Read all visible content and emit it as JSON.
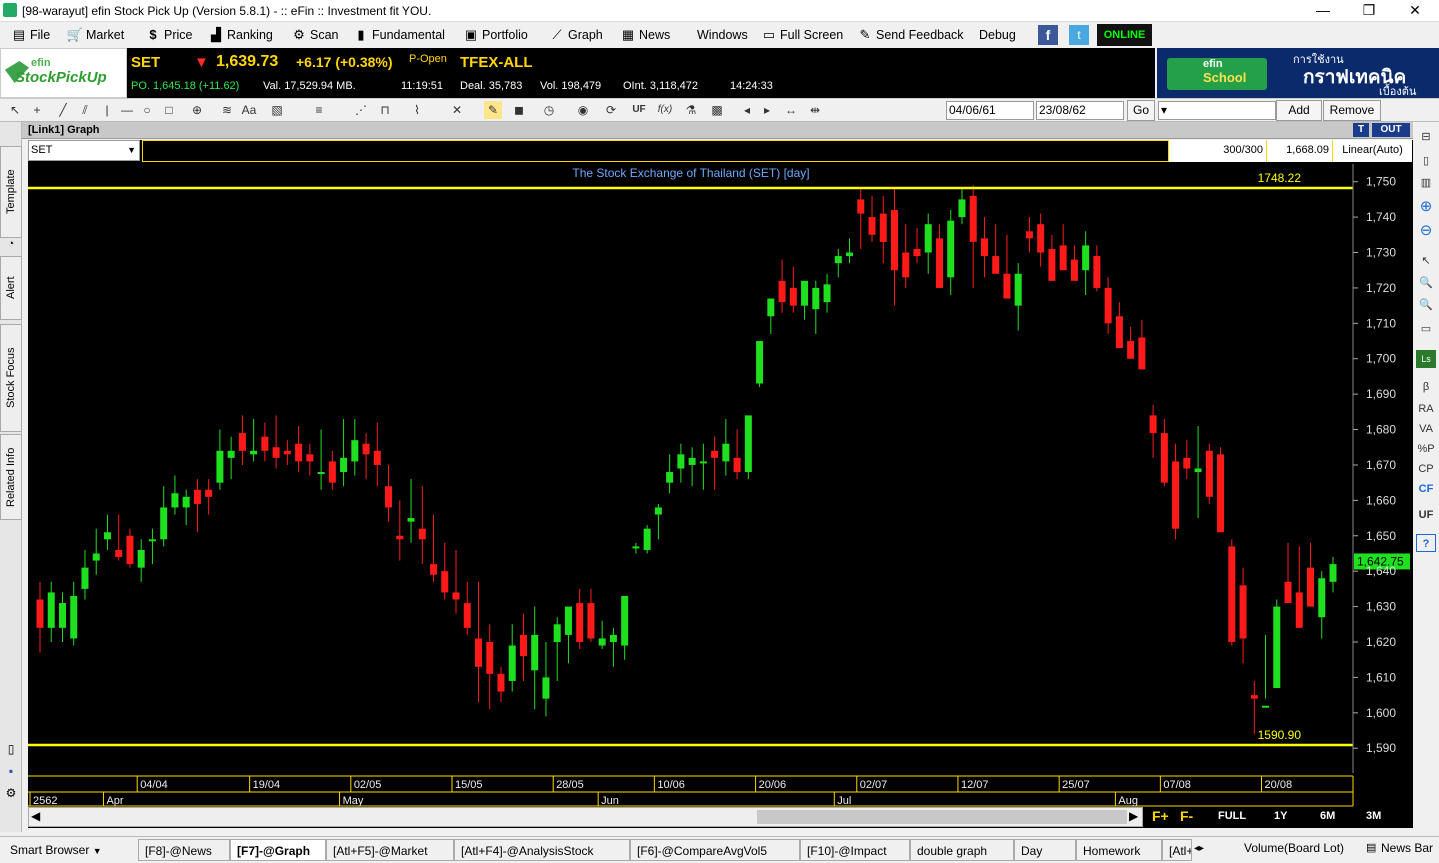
{
  "window": {
    "title": "[98-warayut] efin Stock Pick Up (Version 5.8.1) - :: eFin :: Investment fit YOU.",
    "min": "—",
    "max": "❐",
    "close": "✕"
  },
  "menu": [
    {
      "label": "File",
      "icon": "▤"
    },
    {
      "label": "Market",
      "icon": "🛒"
    },
    {
      "label": "Price",
      "icon": "$"
    },
    {
      "label": "Ranking",
      "icon": "▟"
    },
    {
      "label": "Scan",
      "icon": "⚙"
    },
    {
      "label": "Fundamental",
      "icon": "▮"
    },
    {
      "label": "Portfolio",
      "icon": "▣"
    },
    {
      "label": "Graph",
      "icon": "⟋"
    },
    {
      "label": "News",
      "icon": "▦"
    },
    {
      "label": "Windows",
      "icon": ""
    },
    {
      "label": "Full Screen",
      "icon": "▭"
    },
    {
      "label": "Send Feedback",
      "icon": "✎"
    },
    {
      "label": "Debug",
      "icon": ""
    }
  ],
  "online": "ONLINE",
  "logo": {
    "line1": "efin",
    "line2": "StockPickUp"
  },
  "quote": {
    "symbol": "SET",
    "arrow": "▼",
    "price": "1,639.73",
    "change": "+6.17 (+0.38%)",
    "status": "P-Open",
    "po": "PO. 1,645.18 (+11.62)",
    "val": "Val. 17,529.94 MB.",
    "time1": "11:19:51",
    "tfex": "TFEX-ALL",
    "deal": "Deal. 35,783",
    "vol": "Vol. 198,479",
    "oint": "OInt. 3,118,472",
    "time2": "14:24:33"
  },
  "banner": {
    "brand1": "efin",
    "brand2": "School",
    "th1": "การใช้งาน",
    "th2": "กราฟเทคนิค",
    "th3": "เบื้องต้น"
  },
  "toolbar": {
    "date_from": "04/06/61",
    "date_to": "23/08/62",
    "go": "Go",
    "add": "Add",
    "remove": "Remove"
  },
  "left_tabs": [
    "Template",
    "Alert",
    "Stock Focus",
    "Related Info"
  ],
  "right_icons": [
    "β",
    "RA",
    "VA",
    "%P",
    "CP",
    "CF",
    "UF",
    "?"
  ],
  "panel": {
    "title": "[Link1] Graph",
    "t": "T",
    "out": "OUT",
    "symbol": "SET",
    "count": "300/300",
    "last": "1,668.09",
    "scale": "Linear(Auto)"
  },
  "chart_data": {
    "type": "candlestick",
    "title": "The Stock Exchange of Thailand (SET) [day]",
    "ylim": [
      1583,
      1755
    ],
    "yticks": [
      1590,
      1600,
      1610,
      1620,
      1630,
      1640,
      1650,
      1660,
      1670,
      1680,
      1690,
      1700,
      1710,
      1720,
      1730,
      1740,
      1750
    ],
    "hlines": [
      {
        "value": 1748.22,
        "label": "1748.22"
      },
      {
        "value": 1590.9,
        "label": "1590.90"
      }
    ],
    "last_price": "1,642.75",
    "last_value": 1642.75,
    "date_ticks": [
      {
        "i": 9,
        "label": "04/04"
      },
      {
        "i": 19,
        "label": "19/04"
      },
      {
        "i": 28,
        "label": "02/05"
      },
      {
        "i": 37,
        "label": "15/05"
      },
      {
        "i": 46,
        "label": "28/05"
      },
      {
        "i": 55,
        "label": "10/06"
      },
      {
        "i": 64,
        "label": "20/06"
      },
      {
        "i": 73,
        "label": "02/07"
      },
      {
        "i": 82,
        "label": "12/07"
      },
      {
        "i": 91,
        "label": "25/07"
      },
      {
        "i": 100,
        "label": "07/08"
      },
      {
        "i": 109,
        "label": "20/08"
      }
    ],
    "month_ticks": [
      {
        "i": 0,
        "label": "2562"
      },
      {
        "i": 6,
        "label": "Apr"
      },
      {
        "i": 27,
        "label": "May"
      },
      {
        "i": 50,
        "label": "Jun"
      },
      {
        "i": 71,
        "label": "Jul"
      },
      {
        "i": 96,
        "label": "Aug"
      }
    ],
    "candles": [
      [
        1632,
        1637,
        1617,
        1624
      ],
      [
        1624,
        1637,
        1620,
        1634
      ],
      [
        1624,
        1634,
        1620,
        1631
      ],
      [
        1621,
        1637,
        1619,
        1633
      ],
      [
        1635,
        1646,
        1632,
        1641
      ],
      [
        1643,
        1652,
        1639,
        1645
      ],
      [
        1649,
        1656,
        1646,
        1651
      ],
      [
        1646,
        1656,
        1643,
        1644
      ],
      [
        1650,
        1652,
        1641,
        1642
      ],
      [
        1641,
        1649,
        1637,
        1646
      ],
      [
        1649,
        1652,
        1642,
        1649
      ],
      [
        1649,
        1664,
        1647,
        1658
      ],
      [
        1658,
        1667,
        1656,
        1662
      ],
      [
        1658,
        1663,
        1653,
        1661
      ],
      [
        1663,
        1666,
        1651,
        1659
      ],
      [
        1663,
        1666,
        1656,
        1661
      ],
      [
        1665,
        1680,
        1663,
        1674
      ],
      [
        1672,
        1678,
        1666,
        1674
      ],
      [
        1679,
        1684,
        1670,
        1674
      ],
      [
        1673,
        1683,
        1671,
        1674
      ],
      [
        1678,
        1682,
        1671,
        1674
      ],
      [
        1675,
        1684,
        1669,
        1672
      ],
      [
        1674,
        1677,
        1670,
        1673
      ],
      [
        1676,
        1681,
        1668,
        1671
      ],
      [
        1673,
        1676,
        1667,
        1671
      ],
      [
        1668,
        1680,
        1663,
        1668
      ],
      [
        1671,
        1674,
        1663,
        1665
      ],
      [
        1668,
        1683,
        1664,
        1672
      ],
      [
        1671,
        1683,
        1667,
        1677
      ],
      [
        1676,
        1679,
        1666,
        1673
      ],
      [
        1674,
        1682,
        1664,
        1670
      ],
      [
        1664,
        1670,
        1654,
        1658
      ],
      [
        1650,
        1660,
        1643,
        1649
      ],
      [
        1654,
        1666,
        1648,
        1655
      ],
      [
        1652,
        1664,
        1642,
        1649
      ],
      [
        1642,
        1656,
        1637,
        1639
      ],
      [
        1640,
        1648,
        1632,
        1634
      ],
      [
        1634,
        1646,
        1628,
        1632
      ],
      [
        1631,
        1637,
        1622,
        1624
      ],
      [
        1621,
        1637,
        1603,
        1613
      ],
      [
        1620,
        1625,
        1601,
        1611
      ],
      [
        1611,
        1613,
        1603,
        1606
      ],
      [
        1609,
        1625,
        1606,
        1619
      ],
      [
        1622,
        1628,
        1609,
        1616
      ],
      [
        1612,
        1630,
        1601,
        1622
      ],
      [
        1604,
        1620,
        1599,
        1610
      ],
      [
        1620,
        1627,
        1609,
        1625
      ],
      [
        1622,
        1629,
        1614,
        1630
      ],
      [
        1631,
        1635,
        1618,
        1620
      ],
      [
        1631,
        1635,
        1620,
        1621
      ],
      [
        1619,
        1626,
        1618,
        1621
      ],
      [
        1620,
        1624,
        1613,
        1622
      ],
      [
        1619,
        1633,
        1615,
        1633
      ],
      [
        1647,
        1648,
        1645,
        1647
      ],
      [
        1646,
        1653,
        1645,
        1652
      ],
      [
        1656,
        1659,
        1649,
        1658
      ],
      [
        1665,
        1673,
        1662,
        1668
      ],
      [
        1669,
        1676,
        1665,
        1673
      ],
      [
        1670,
        1675,
        1664,
        1672
      ],
      [
        1671,
        1676,
        1663,
        1671
      ],
      [
        1674,
        1678,
        1663,
        1672
      ],
      [
        1671,
        1683,
        1667,
        1676
      ],
      [
        1672,
        1680,
        1666,
        1668
      ],
      [
        1668,
        1684,
        1666,
        1684
      ],
      [
        1693,
        1697,
        1692,
        1705
      ],
      [
        1712,
        1717,
        1707,
        1717
      ],
      [
        1722,
        1728,
        1713,
        1716
      ],
      [
        1720,
        1726,
        1713,
        1715
      ],
      [
        1715,
        1720,
        1711,
        1722
      ],
      [
        1714,
        1722,
        1707,
        1720
      ],
      [
        1716,
        1724,
        1713,
        1721
      ],
      [
        1727,
        1731,
        1723,
        1729
      ],
      [
        1729,
        1734,
        1727,
        1730
      ],
      [
        1745,
        1748,
        1731,
        1741
      ],
      [
        1740,
        1746,
        1733,
        1735
      ],
      [
        1741,
        1746,
        1727,
        1733
      ],
      [
        1742,
        1748,
        1715,
        1725
      ],
      [
        1730,
        1738,
        1720,
        1723
      ],
      [
        1731,
        1737,
        1727,
        1729
      ],
      [
        1730,
        1741,
        1724,
        1738
      ],
      [
        1734,
        1738,
        1727,
        1720
      ],
      [
        1723,
        1742,
        1718,
        1739
      ],
      [
        1740,
        1748,
        1738,
        1745
      ],
      [
        1746,
        1749,
        1720,
        1733
      ],
      [
        1734,
        1740,
        1723,
        1729
      ],
      [
        1729,
        1738,
        1724,
        1724
      ],
      [
        1724,
        1735,
        1719,
        1717
      ],
      [
        1715,
        1727,
        1708,
        1724
      ],
      [
        1736,
        1740,
        1730,
        1734
      ],
      [
        1738,
        1741,
        1726,
        1730
      ],
      [
        1731,
        1735,
        1723,
        1722
      ],
      [
        1732,
        1738,
        1725,
        1725
      ],
      [
        1728,
        1732,
        1725,
        1722
      ],
      [
        1725,
        1736,
        1718,
        1732
      ],
      [
        1729,
        1732,
        1719,
        1720
      ],
      [
        1720,
        1723,
        1707,
        1710
      ],
      [
        1712,
        1716,
        1706,
        1703
      ],
      [
        1705,
        1709,
        1701,
        1700
      ],
      [
        1706,
        1711,
        1697,
        1697
      ],
      [
        1684,
        1687,
        1672,
        1679
      ],
      [
        1679,
        1683,
        1664,
        1665
      ],
      [
        1671,
        1676,
        1649,
        1652
      ],
      [
        1672,
        1677,
        1666,
        1669
      ],
      [
        1668,
        1681,
        1655,
        1669
      ],
      [
        1674,
        1676,
        1659,
        1661
      ],
      [
        1673,
        1675,
        1654,
        1651
      ],
      [
        1647,
        1649,
        1619,
        1620
      ],
      [
        1636,
        1641,
        1614,
        1621
      ],
      [
        1605,
        1609,
        1594,
        1604
      ],
      [
        1602,
        1622,
        1604,
        1602
      ],
      [
        1607,
        1632,
        1607,
        1630
      ],
      [
        1637,
        1648,
        1632,
        1631
      ],
      [
        1634,
        1647,
        1624,
        1624
      ],
      [
        1641,
        1648,
        1632,
        1630
      ],
      [
        1627,
        1640,
        1621,
        1638
      ],
      [
        1637,
        1644,
        1634,
        1642
      ]
    ]
  },
  "status": {
    "smart": "Smart Browser",
    "tabs": [
      "[F8]-@News",
      "[F7]-@Graph",
      "[Atl+F5]-@Market",
      "[Atl+F4]-@AnalysisStock",
      "[F6]-@CompareAvgVol5",
      "[F10]-@Impact",
      "double graph",
      "Day",
      "Homework",
      "[Atl+"
    ],
    "volume": "Volume(Board Lot)",
    "newsbar": "News Bar"
  },
  "period_buttons": [
    "FULL",
    "1Y",
    "6M",
    "3M"
  ]
}
